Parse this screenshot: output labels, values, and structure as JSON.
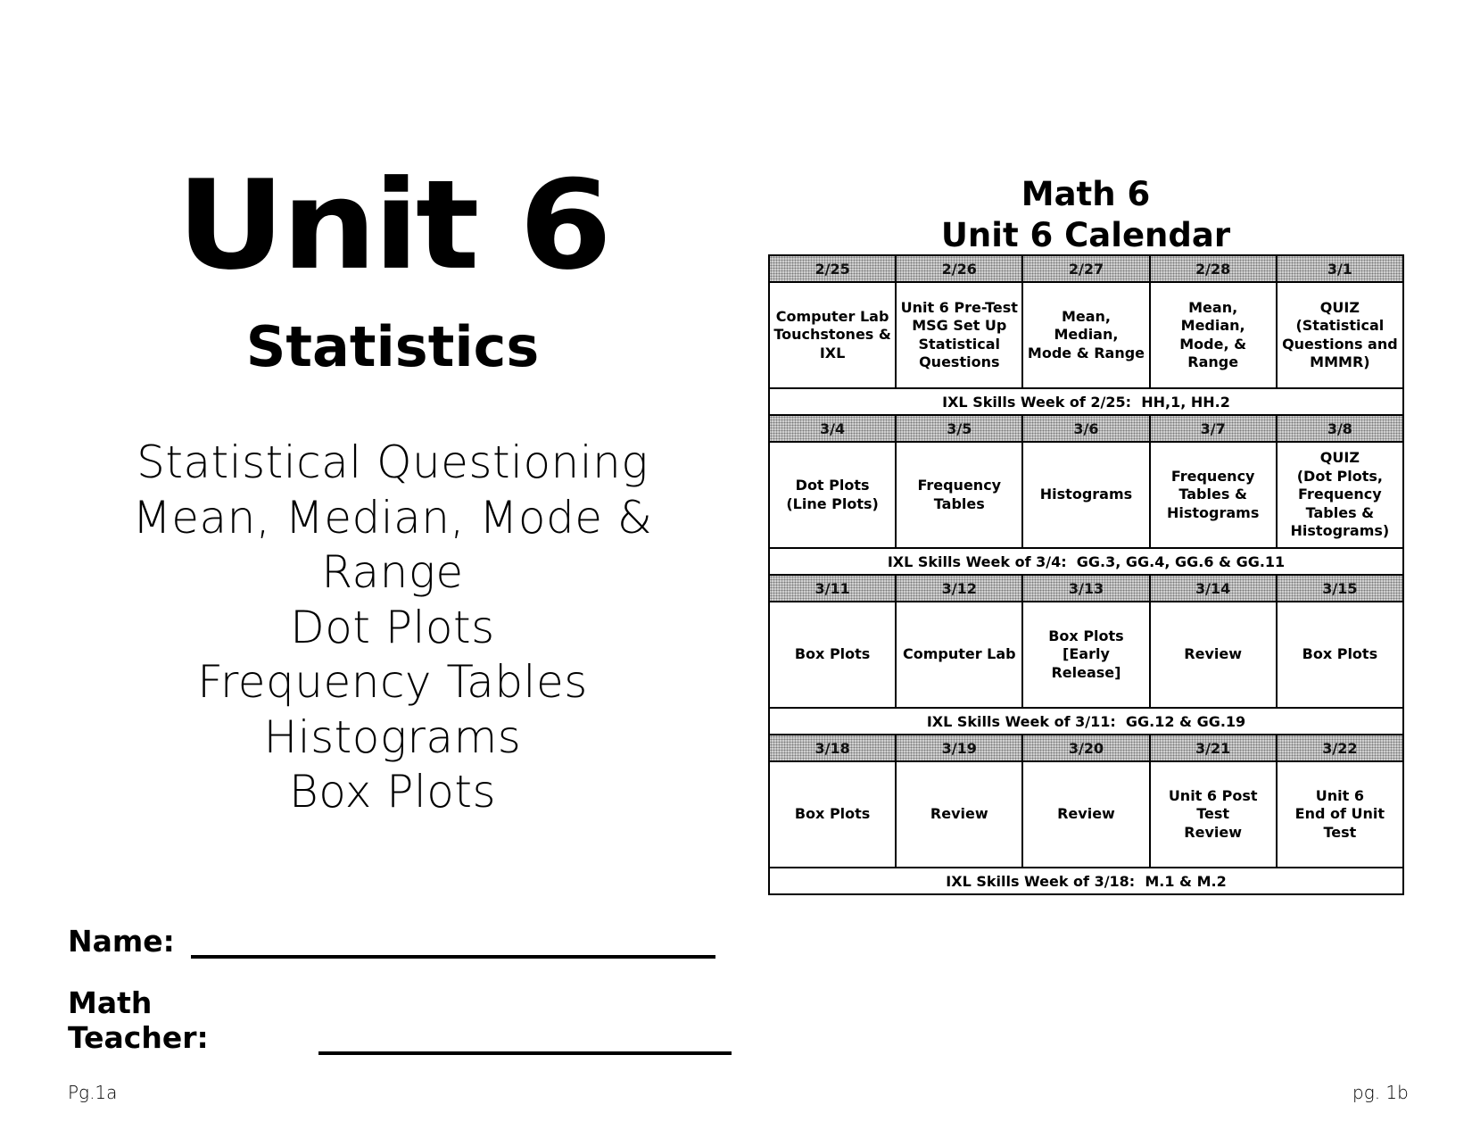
{
  "left_page": {
    "title": "Unit 6",
    "subtitle": "Statistics",
    "topics": [
      "Statistical Questioning",
      "Mean, Median, Mode &",
      "Range",
      "Dot Plots",
      "Frequency Tables",
      "Histograms",
      "Box Plots"
    ],
    "fields": {
      "name_label": "Name:",
      "teacher_label": "Math Teacher:"
    },
    "page_number": "Pg.1a"
  },
  "right_page": {
    "title_line1": "Math 6",
    "title_line2": "Unit 6 Calendar",
    "weeks": [
      {
        "dates": [
          "2/25",
          "2/26",
          "2/27",
          "2/28",
          "3/1"
        ],
        "activities": [
          "Computer Lab\nTouchstones &\nIXL",
          "Unit 6 Pre-Test\nMSG Set Up\nStatistical\nQuestions",
          "Mean, Median,\nMode & Range",
          "Mean, Median,\nMode, & Range",
          "QUIZ\n(Statistical\nQuestions and\nMMMR)"
        ],
        "ixl": "IXL Skills Week of 2/25:  HH,1, HH.2"
      },
      {
        "dates": [
          "3/4",
          "3/5",
          "3/6",
          "3/7",
          "3/8"
        ],
        "activities": [
          "Dot Plots\n(Line Plots)",
          "Frequency\nTables",
          "Histograms",
          "Frequency\nTables &\nHistograms",
          "QUIZ\n(Dot Plots,\nFrequency\nTables &\nHistograms)"
        ],
        "ixl": "IXL Skills Week of 3/4:  GG.3, GG.4, GG.6 & GG.11"
      },
      {
        "dates": [
          "3/11",
          "3/12",
          "3/13",
          "3/14",
          "3/15"
        ],
        "activities": [
          "Box Plots",
          "Computer Lab",
          "Box Plots\n[Early Release]",
          "Review",
          "Box Plots"
        ],
        "ixl": "IXL Skills Week of 3/11:  GG.12 & GG.19"
      },
      {
        "dates": [
          "3/18",
          "3/19",
          "3/20",
          "3/21",
          "3/22"
        ],
        "activities": [
          "Box Plots",
          "Review",
          "Review",
          "Unit 6 Post Test\nReview",
          "Unit 6\nEnd of Unit Test"
        ],
        "ixl": "IXL Skills Week of 3/18:  M.1 & M.2"
      }
    ],
    "page_number": "pg. 1b"
  }
}
